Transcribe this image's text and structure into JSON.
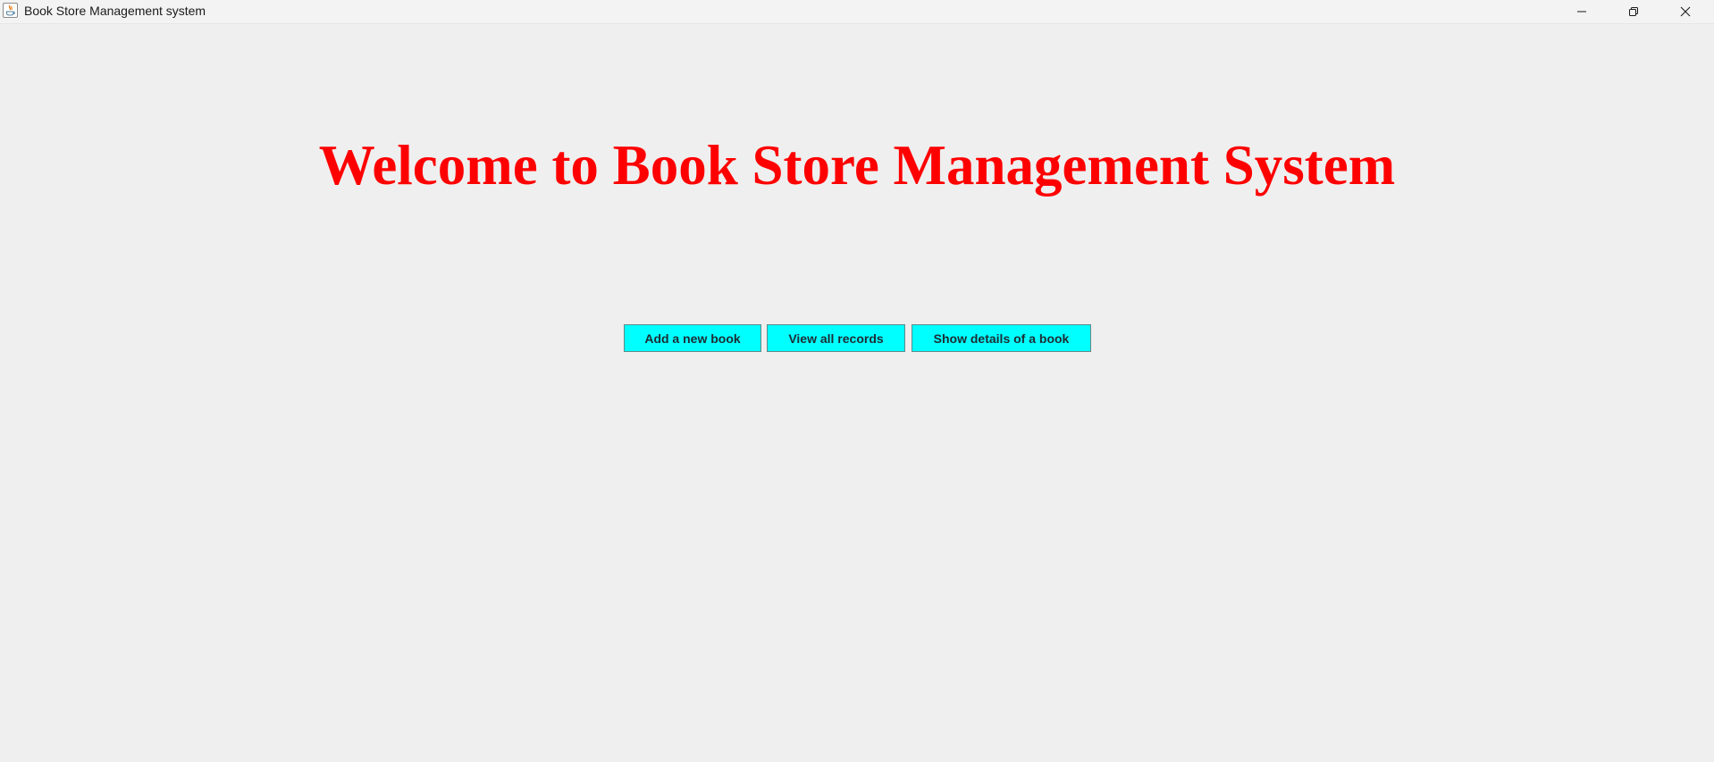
{
  "window": {
    "title": "Book Store Management system",
    "controls": {
      "minimize_icon": "minimize-icon",
      "restore_icon": "restore-icon",
      "close_icon": "close-icon"
    }
  },
  "main": {
    "heading": "Welcome to Book Store Management System",
    "heading_color": "#ff0000",
    "buttons": [
      {
        "label": "Add a new book"
      },
      {
        "label": "View all records"
      },
      {
        "label": "Show details of a book"
      }
    ],
    "button_color": "#00ffff"
  }
}
